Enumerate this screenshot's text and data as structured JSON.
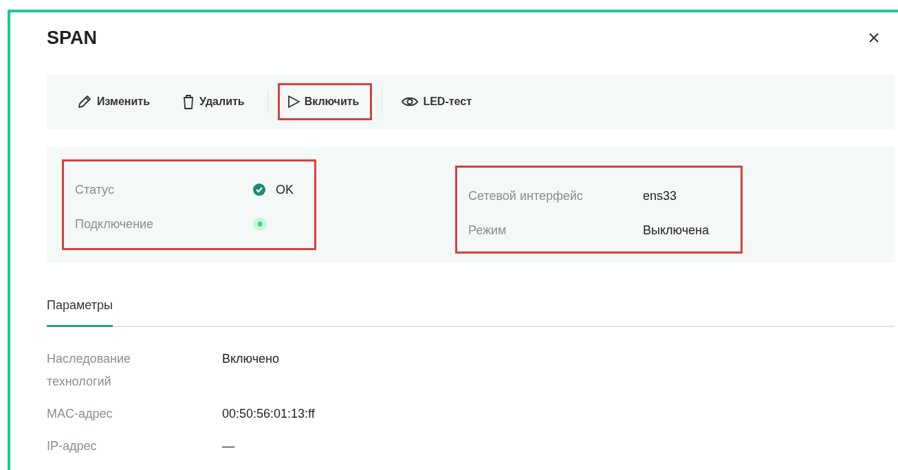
{
  "dialog": {
    "title": "SPAN"
  },
  "toolbar": [
    {
      "label": "Изменить",
      "highlighted": false
    },
    {
      "label": "Удалить",
      "highlighted": false
    },
    {
      "label": "Включить",
      "highlighted": true
    },
    {
      "label": "LED-тест",
      "highlighted": false
    }
  ],
  "info_groups": [
    {
      "highlighted": true,
      "rows": [
        {
          "label": "Статус",
          "kind": "status",
          "value": "OK"
        },
        {
          "label": "Подключение",
          "kind": "indicator"
        }
      ]
    },
    {
      "highlighted": true,
      "rows": [
        {
          "label": "Сетевой интерфейс",
          "kind": "text",
          "value": "ens33"
        },
        {
          "label": "Режим",
          "kind": "text",
          "value": "Выключена"
        }
      ]
    }
  ],
  "tabs": [
    {
      "label": "Параметры",
      "selected": true
    }
  ],
  "parameters": [
    {
      "label": "Наследование технологий",
      "value": "Включено"
    },
    {
      "label": "MAC-адрес",
      "value": "00:50:56:01:13:ff"
    },
    {
      "label": "IP-адрес",
      "value": "—"
    }
  ]
}
